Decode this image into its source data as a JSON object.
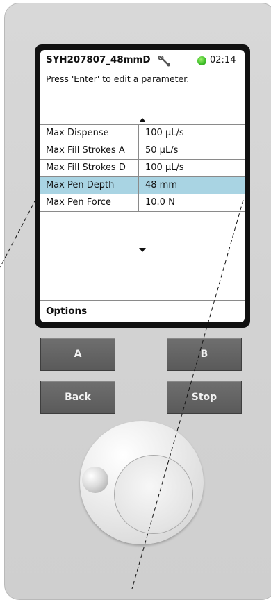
{
  "screen": {
    "title": "SYH207807_48mmD",
    "time": "02:14",
    "hint": "Press 'Enter' to edit a parameter.",
    "icons": {
      "wrench": "wrench-icon",
      "status": "status-dot-green",
      "status_color": "#3fbf2a"
    },
    "parameters": [
      {
        "name": "Max Dispense",
        "value": "100 µL/s",
        "selected": false
      },
      {
        "name": "Max Fill Strokes A",
        "value": "50 µL/s",
        "selected": false
      },
      {
        "name": "Max Fill Strokes D",
        "value": "100 µL/s",
        "selected": false
      },
      {
        "name": "Max Pen Depth",
        "value": "48 mm",
        "selected": true
      },
      {
        "name": "Max Pen Force",
        "value": "10.0 N",
        "selected": false
      }
    ],
    "options_label": "Options",
    "highlight_color": "#a9d4e3"
  },
  "hardware_buttons": {
    "a": "A",
    "b": "B",
    "back": "Back",
    "stop": "Stop"
  }
}
